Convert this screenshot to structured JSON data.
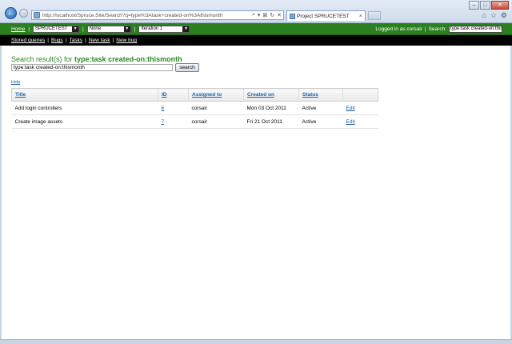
{
  "browser": {
    "url": "http://localhost/Spruce.Site/Search?q=type%3Atask+created-on%3Athismonth",
    "tab_title": "Project SPRUCETEST",
    "tab_close": "×",
    "back_glyph": "←",
    "forward_glyph": "→",
    "addr_tools": [
      "⌕",
      "▾",
      "⊠",
      "↻",
      "✕"
    ],
    "right_icons": [
      "⌂",
      "☆",
      "⚙"
    ],
    "window_buttons": [
      "–",
      "□",
      "✕"
    ]
  },
  "appbar": {
    "home_label": "Home",
    "project_select": "SPRUCETEST",
    "filter_select": "None",
    "iteration_select": "Iteration 1",
    "logged_in_text": "Logged in as corsair",
    "search_label": "Search:",
    "search_value": "type:task created-on:thismonth"
  },
  "subnav": {
    "items": [
      "Stored queries",
      "Bugs",
      "Tasks",
      "New task",
      "New bug"
    ]
  },
  "main": {
    "heading_prefix": "Search result(s) for",
    "heading_query": "type:task created-on:thismonth",
    "query_value": "type:task created-on:thismonth",
    "search_button": "search",
    "help_link": "Help"
  },
  "table": {
    "columns": [
      "Title",
      "ID",
      "Assigned to",
      "Created on",
      "Status",
      ""
    ],
    "rows": [
      {
        "title": "Add login controllers",
        "id": "6",
        "assigned_to": "corsair",
        "created_on": "Mon 03 Oct 2011",
        "status": "Active",
        "action": "Edit"
      },
      {
        "title": "Create image assets",
        "id": "7",
        "assigned_to": "corsair",
        "created_on": "Fri 21 Oct 2011",
        "status": "Active",
        "action": "Edit"
      }
    ]
  },
  "colors": {
    "appbar": "#2a7f1e",
    "subnav": "#000000",
    "heading": "#2a8a22",
    "link": "#1d5fa8"
  }
}
